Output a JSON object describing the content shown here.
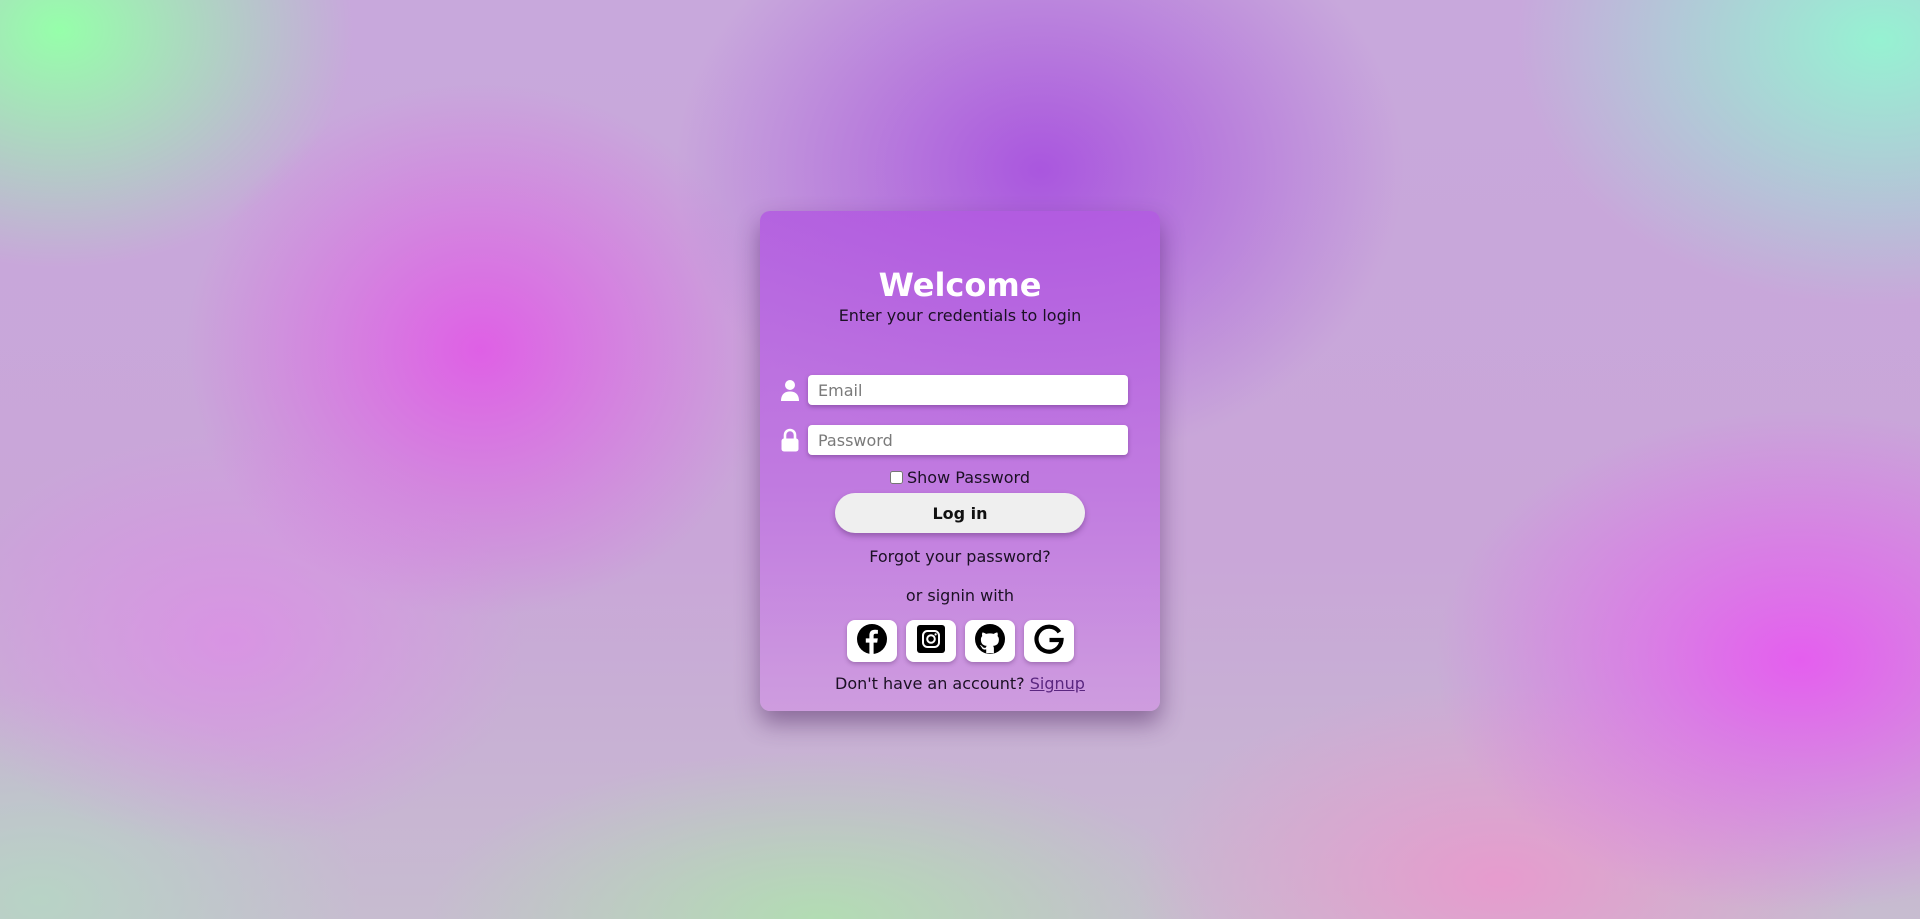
{
  "login": {
    "title": "Welcome",
    "subtitle": "Enter your credentials to login",
    "email": {
      "placeholder": "Email",
      "value": "",
      "icon": "user-icon"
    },
    "password": {
      "placeholder": "Password",
      "value": "",
      "icon": "lock-icon"
    },
    "show_password": {
      "label": "Show Password",
      "checked": false
    },
    "login_button": "Log in",
    "forgot_password": "Forgot your password?",
    "or_signin": "or signin with",
    "social": [
      {
        "icon": "facebook-icon"
      },
      {
        "icon": "instagram-icon"
      },
      {
        "icon": "github-icon"
      },
      {
        "icon": "google-icon"
      }
    ],
    "signup_prompt": "Don't have an account?",
    "signup_link": "Signup"
  },
  "colors": {
    "card_top": "#b25ae0",
    "text_dark": "#1b1024",
    "link": "#5a2680",
    "button_bg": "#efefef"
  }
}
